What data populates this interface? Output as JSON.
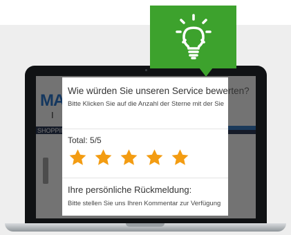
{
  "popup": {
    "title": "Wie würden Sie unseren Service bewerten?",
    "subtitle": "Bitte Klicken Sie auf die Anzahl der Sterne mit der Sie",
    "total_label": "Total: 5/5",
    "rating": 5,
    "rating_max": 5,
    "feedback_title": "Ihre persönliche Rückmeldung:",
    "feedback_subtitle": "Bitte stellen Sie uns Ihren Kommentar zur Verfügung"
  },
  "background_site": {
    "logo": "MAD",
    "logo_sub": "I S",
    "nav_text": "SHOPPING"
  },
  "icons": {
    "bulb": "lightbulb-icon",
    "star": "star-icon"
  },
  "colors": {
    "accent_green": "#3da22d",
    "star_orange": "#f39c12",
    "laptop_bezel": "#101214"
  }
}
